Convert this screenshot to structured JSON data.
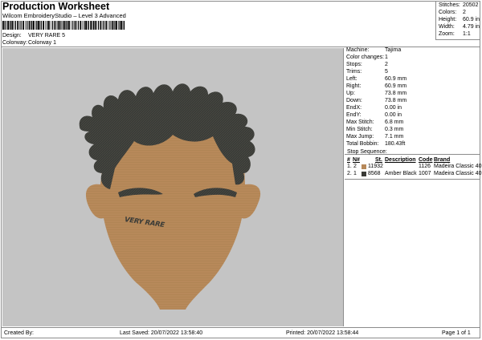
{
  "header": {
    "title": "Production Worksheet",
    "subtitle": "Wilcom EmbroideryStudio – Level 3 Advanced",
    "design_label": "Design:",
    "design_value": "VERY RARE 5",
    "colorway_label": "Colorway:",
    "colorway_value": "Colorway 1"
  },
  "summary": {
    "stitches_label": "Stitches:",
    "stitches": "20502",
    "colors_label": "Colors:",
    "colors": "2",
    "height_label": "Height:",
    "height": "60.9 in",
    "width_label": "Width:",
    "width": "4.79 in",
    "zoom_label": "Zoom:",
    "zoom": "1:1"
  },
  "details": [
    {
      "label": "Machine:",
      "value": "Tajima"
    },
    {
      "label": "Color changes:",
      "value": "1"
    },
    {
      "label": "Stops:",
      "value": "2"
    },
    {
      "label": "Trims:",
      "value": "5"
    },
    {
      "label": "Left:",
      "value": "60.9 mm"
    },
    {
      "label": "Right:",
      "value": "60.9 mm"
    },
    {
      "label": "Up:",
      "value": "73.8 mm"
    },
    {
      "label": "Down:",
      "value": "73.8 mm"
    },
    {
      "label": "EndX:",
      "value": "0.00 in"
    },
    {
      "label": "EndY:",
      "value": "0.00 in"
    },
    {
      "label": "Max Stitch:",
      "value": "6.8 mm"
    },
    {
      "label": "Min Stitch:",
      "value": "0.3 mm"
    },
    {
      "label": "Max Jump:",
      "value": "7.1 mm"
    },
    {
      "label": "Total Bobbin:",
      "value": "180.43ft"
    }
  ],
  "stop_sequence": {
    "label": "Stop Sequence:",
    "headers": {
      "num": "#",
      "n": "N#",
      "st": "St.",
      "description": "Description",
      "code": "Code",
      "brand": "Brand"
    },
    "rows": [
      {
        "num": "1.",
        "n": "2",
        "color": "#b7895a",
        "st": "11932",
        "description": "",
        "code": "1126",
        "brand": "Madeira Classic 40"
      },
      {
        "num": "2.",
        "n": "1",
        "color": "#3a3b37",
        "st": "8568",
        "description": "Amber Black",
        "code": "1007",
        "brand": "Madeira Classic 40"
      }
    ]
  },
  "design": {
    "tattoo_text": "VERY RARE",
    "skin_color": "#b7895a",
    "hair_color": "#3a3b37",
    "background_color": "#c4c4c4"
  },
  "footer": {
    "created_by": "Created By:",
    "last_saved": "Last Saved: 20/07/2022 13:58:40",
    "printed": "Printed: 20/07/2022 13:58:44",
    "page": "Page 1 of 1"
  }
}
